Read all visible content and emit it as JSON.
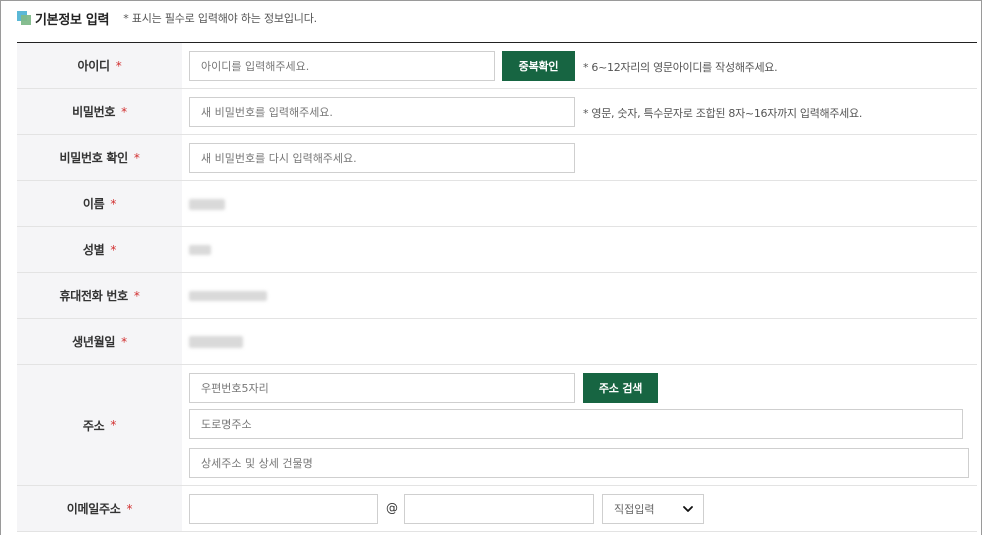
{
  "section": {
    "title": "기본정보 입력",
    "note": "* 표시는 필수로 입력해야 하는 정보입니다."
  },
  "required_mark": "*",
  "fields": {
    "userid": {
      "label": "아이디",
      "placeholder": "아이디를 입력해주세요.",
      "button": "중복확인",
      "hint": "* 6~12자리의 영문아이디를 작성해주세요."
    },
    "password": {
      "label": "비밀번호",
      "placeholder": "새 비밀번호를 입력해주세요.",
      "hint": "* 영문, 숫자, 특수문자로 조합된 8자~16자까지 입력해주세요."
    },
    "password_confirm": {
      "label": "비밀번호 확인",
      "placeholder": "새 비밀번호를 다시 입력해주세요."
    },
    "name": {
      "label": "이름"
    },
    "gender": {
      "label": "성별"
    },
    "phone": {
      "label": "휴대전화 번호"
    },
    "birth": {
      "label": "생년월일"
    },
    "address": {
      "label": "주소",
      "postcode_placeholder": "우편번호5자리",
      "search_button": "주소 검색",
      "road_placeholder": "도로명주소",
      "detail_placeholder": "상세주소 및 상세 건물명"
    },
    "email": {
      "label": "이메일주소",
      "at_sign": "@",
      "domain_select": "직접입력"
    }
  },
  "icons": {
    "section": "section-title-icon",
    "select": "chevron-down-icon"
  },
  "colors": {
    "accent_button": "#176542",
    "required": "#d23030",
    "label_background": "#f5f5f7"
  }
}
